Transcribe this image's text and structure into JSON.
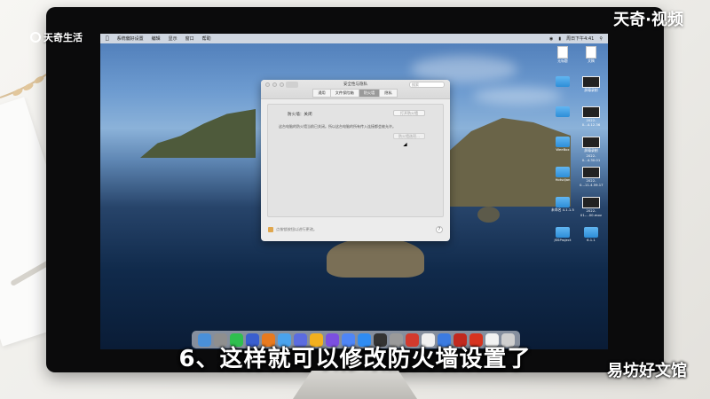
{
  "overlay": {
    "logo_top_left": "天奇生活",
    "logo_top_right": "天奇·视频",
    "subtitle": "6、这样就可以修改防火墙设置了",
    "watermark_bottom_right": "易坊好文馆"
  },
  "menubar": {
    "app_name": "系统偏好设置",
    "items": [
      "编辑",
      "显示",
      "窗口",
      "帮助"
    ],
    "clock": "周日下午4:41"
  },
  "prefs_window": {
    "title": "安全性与隐私",
    "search_placeholder": "搜索",
    "tabs": [
      "通用",
      "文件保险箱",
      "防火墙",
      "隐私"
    ],
    "selected_tab": "防火墙",
    "firewall_status": "防火墙：关闭",
    "enable_button": "打开防火墙",
    "description": "这台电脑的防火墙当前已关闭。所以这台电脑的所有传入连接都会被允许。",
    "options_button": "防火墙选项…",
    "lock_label": "点按锁按钮以进行更改。",
    "help_label": "?"
  },
  "desktop_icons": [
    {
      "label": "无标题",
      "kind": "file"
    },
    {
      "label": "文稿",
      "kind": "file"
    },
    {
      "label": "",
      "kind": "folder"
    },
    {
      "label": "屏幕录制",
      "kind": "shot"
    },
    {
      "label": "",
      "kind": "folder"
    },
    {
      "label": "2022-0...4.12.36",
      "kind": "shot"
    },
    {
      "label": "WeeBox",
      "kind": "folder"
    },
    {
      "label": "屏幕录制 2022-0...4.30.01",
      "kind": "shot"
    },
    {
      "label": "Hotsdjan",
      "kind": "folder"
    },
    {
      "label": "2022-0...11.4.59.17",
      "kind": "shot"
    },
    {
      "label": "未命名 4.1.1.5",
      "kind": "folder"
    },
    {
      "label": "2022-01-...00.mov",
      "kind": "shot"
    },
    {
      "label": "JSSProject",
      "kind": "folder"
    },
    {
      "label": "6.1.1",
      "kind": "folder"
    }
  ],
  "dock_colors": [
    "#4a90d9",
    "#8f8f8f",
    "#2fbf4f",
    "#3a5fcf",
    "#e87a1f",
    "#4aa3ee",
    "#5b6ce0",
    "#f2b01f",
    "#7b4fe0",
    "#4f86f7",
    "#2f8cf2",
    "#333333",
    "#9a9a9a",
    "#d23a2e",
    "#f0f0f0",
    "#3c7be0",
    "#c1291f",
    "#d6331f",
    "#f2f2f2",
    "#cfcfcf"
  ]
}
